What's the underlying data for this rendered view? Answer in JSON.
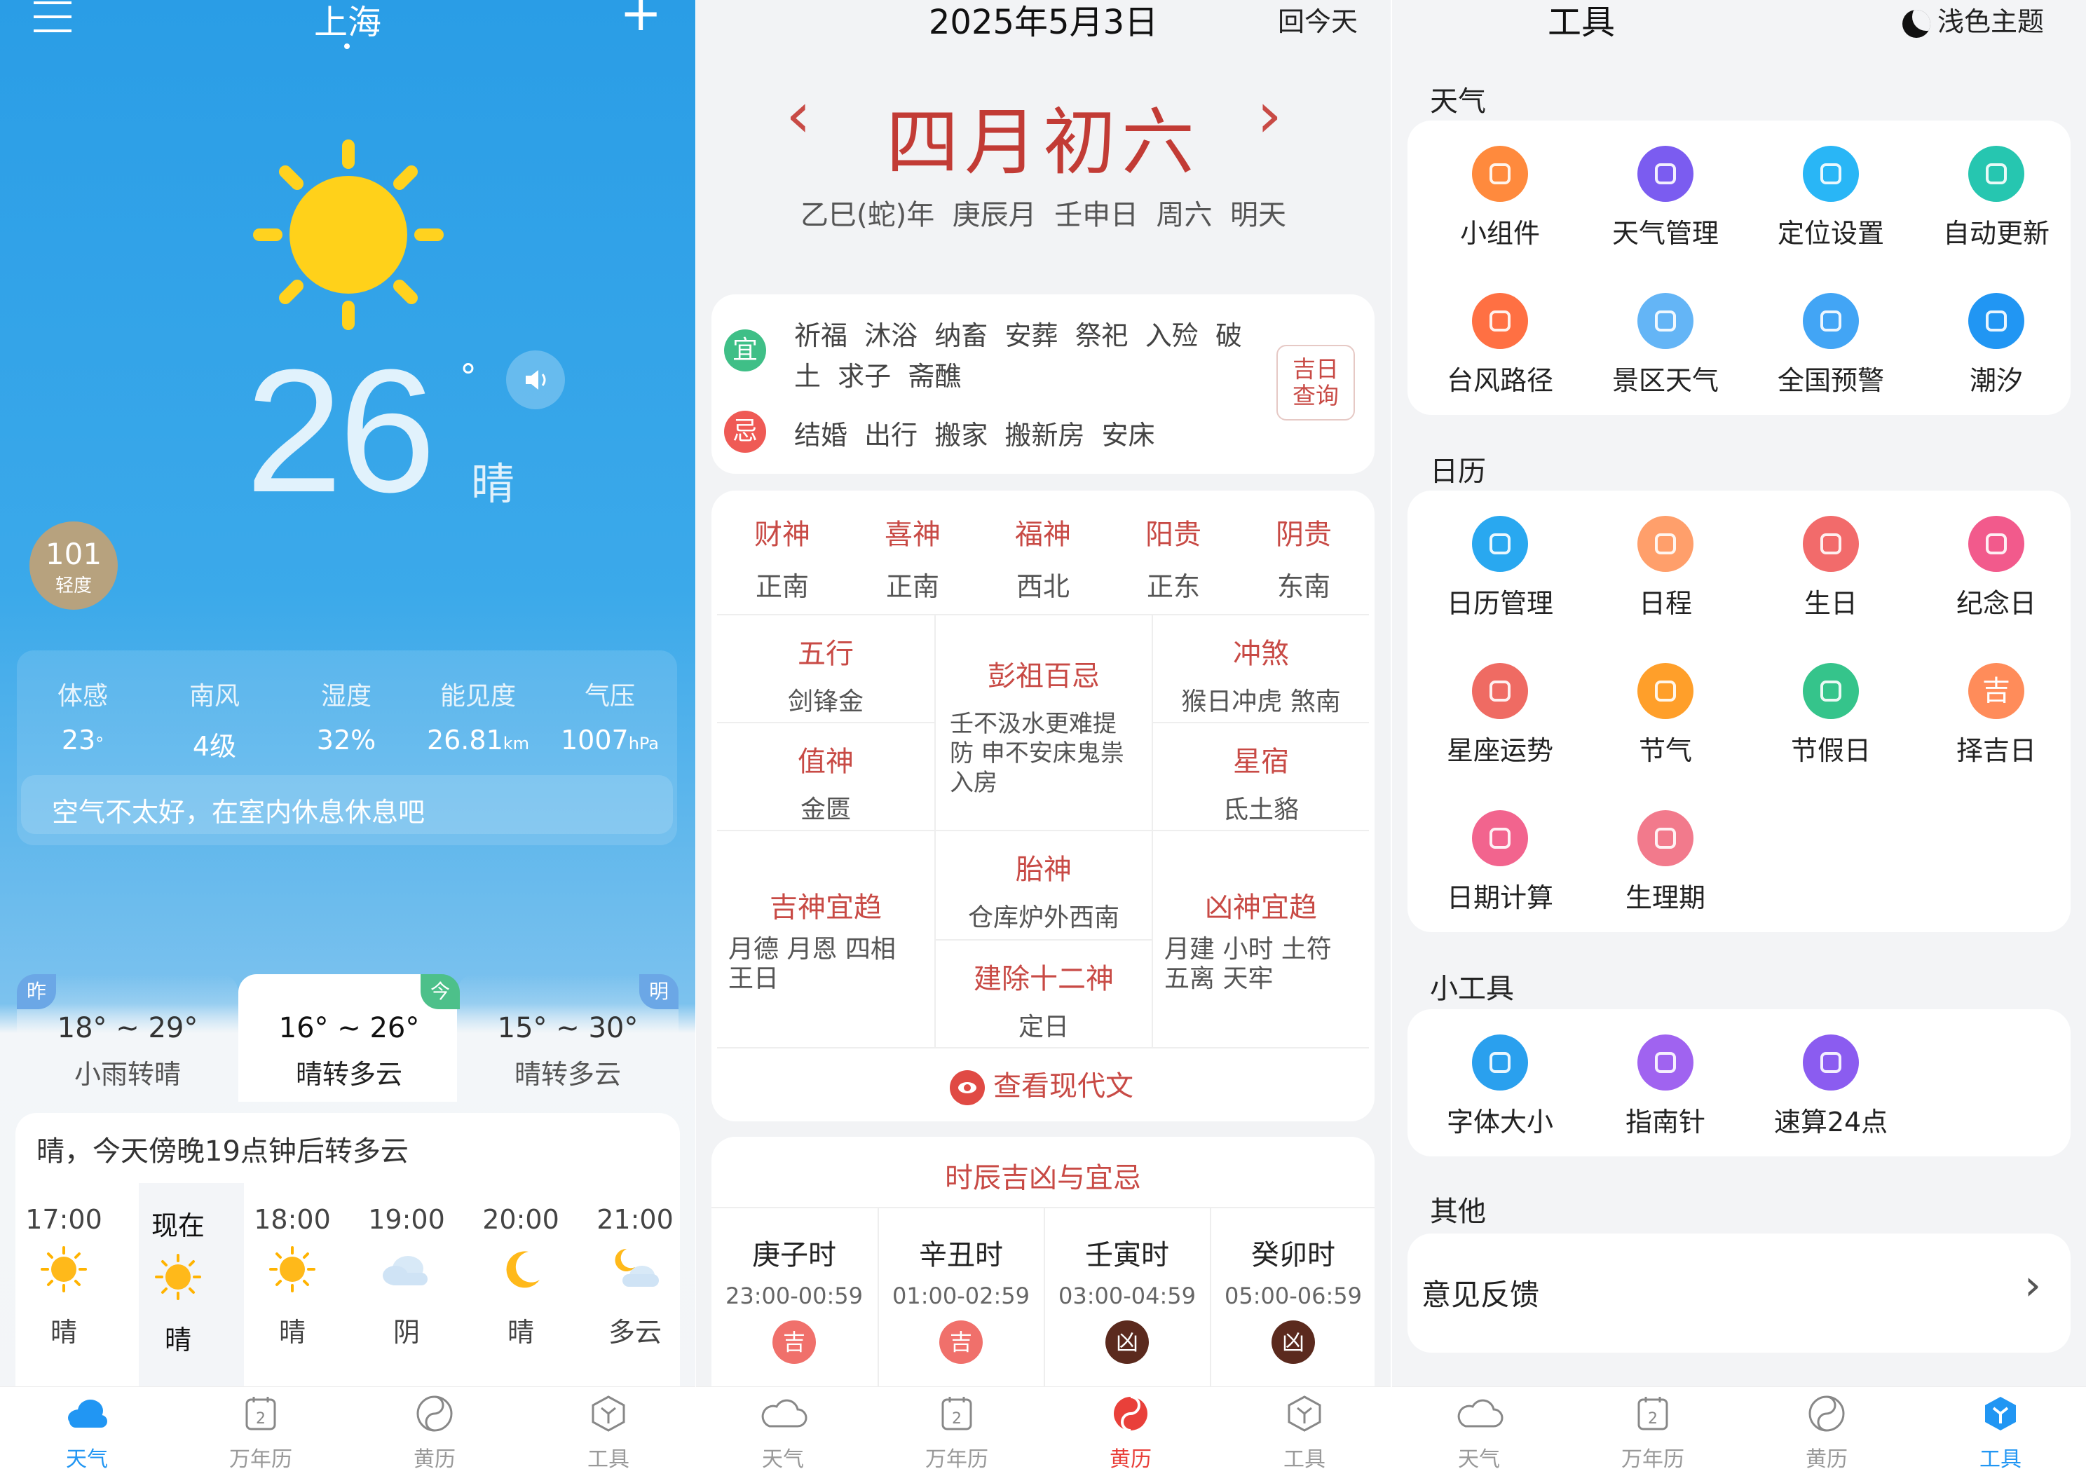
{
  "weather": {
    "city": "上海",
    "temp": "26",
    "degree": "°",
    "condition": "晴",
    "aqi_value": "101",
    "aqi_level": "轻度",
    "stats": [
      {
        "label": "体感",
        "value": "23",
        "unit": "°"
      },
      {
        "label": "南风",
        "value": "4级",
        "unit": ""
      },
      {
        "label": "湿度",
        "value": "32%",
        "unit": ""
      },
      {
        "label": "能见度",
        "value": "26.81",
        "unit": "km"
      },
      {
        "label": "气压",
        "value": "1007",
        "unit": "hPa"
      }
    ],
    "tip": "空气不太好，在室内休息休息吧",
    "days": [
      {
        "tag": "昨",
        "range": "18° ~ 29°",
        "desc": "小雨转晴"
      },
      {
        "tag": "今",
        "range": "16° ~ 26°",
        "desc": "晴转多云"
      },
      {
        "tag": "明",
        "range": "15° ~ 30°",
        "desc": "晴转多云"
      }
    ],
    "summary": "晴，今天傍晚19点钟后转多云",
    "hourly": [
      {
        "time": "17:00",
        "icon": "sun-icon",
        "cond": "晴"
      },
      {
        "time": "现在",
        "icon": "sun-icon",
        "cond": "晴"
      },
      {
        "time": "18:00",
        "icon": "sun-icon",
        "cond": "晴"
      },
      {
        "time": "19:00",
        "icon": "cloud-icon",
        "cond": "阴"
      },
      {
        "time": "20:00",
        "icon": "moon-icon",
        "cond": "晴"
      },
      {
        "time": "21:00",
        "icon": "moon-cloud-icon",
        "cond": "多云"
      }
    ]
  },
  "nav": [
    "天气",
    "万年历",
    "黄历",
    "工具"
  ],
  "almanac": {
    "date": "2025年5月3日",
    "today_btn": "回今天",
    "lunar": "四月初六",
    "ganzhi": "乙巳(蛇)年  庚辰月  壬申日  周六  明天",
    "yi_badge": "宜",
    "ji_badge": "忌",
    "yi_line1": "祈福  沐浴  纳畜  安葬  祭祀  入殓  破",
    "yi_line2": "土  求子  斋醮",
    "ji_line": "结婚  出行  搬家  搬新房  安床",
    "query_btn": [
      "吉日",
      "查询"
    ],
    "gods": [
      {
        "name": "财神",
        "dir": "正南"
      },
      {
        "name": "喜神",
        "dir": "正南"
      },
      {
        "name": "福神",
        "dir": "西北"
      },
      {
        "name": "阳贵",
        "dir": "正东"
      },
      {
        "name": "阴贵",
        "dir": "东南"
      }
    ],
    "wuxing_title": "五行",
    "wuxing_val": "剑锋金",
    "pengzu_title": "彭祖百忌",
    "pengzu_val": "壬不汲水更难提防 申不安床鬼祟入房",
    "chongsha_title": "冲煞",
    "chongsha_val": "猴日冲虎 煞南",
    "zhishen_title": "值神",
    "zhishen_val": "金匮",
    "xingxiu_title": "星宿",
    "xingxiu_val": "氐土貉",
    "taishen_title": "胎神",
    "taishen_val": "仓库炉外西南",
    "jishen_title": "吉神宜趋",
    "jishen_val": "月德 月恩 四相 王日",
    "xiongshen_title": "凶神宜趋",
    "xiongshen_val": "月建 小时 土符 五离 天牢",
    "jianchu_title": "建除十二神",
    "jianchu_val": "定日",
    "modern_btn": "查看现代文",
    "hours_title": "时辰吉凶与宜忌",
    "hours": [
      {
        "name": "庚子时",
        "range": "23:00-00:59",
        "luck": "吉"
      },
      {
        "name": "辛丑时",
        "range": "01:00-02:59",
        "luck": "吉"
      },
      {
        "name": "壬寅时",
        "range": "03:00-04:59",
        "luck": "凶"
      },
      {
        "name": "癸卯时",
        "range": "05:00-06:59",
        "luck": "凶"
      }
    ]
  },
  "tools": {
    "title": "工具",
    "theme": "浅色主题",
    "sections": {
      "weather": "天气",
      "calendar": "日历",
      "small": "小工具",
      "other": "其他"
    },
    "weather_items": [
      {
        "label": "小组件",
        "icon": "widget-icon",
        "color": "#ff8a3d"
      },
      {
        "label": "天气管理",
        "icon": "list-icon",
        "color": "#7b5cf0"
      },
      {
        "label": "定位设置",
        "icon": "location-icon",
        "color": "#29b6f6"
      },
      {
        "label": "自动更新",
        "icon": "refresh-icon",
        "color": "#26c6b0"
      },
      {
        "label": "台风路径",
        "icon": "typhoon-icon",
        "color": "#ff7043"
      },
      {
        "label": "景区天气",
        "icon": "scenic-icon",
        "color": "#64b5f6"
      },
      {
        "label": "全国预警",
        "icon": "warning-icon",
        "color": "#42a5f5"
      },
      {
        "label": "潮汐",
        "icon": "tide-icon",
        "color": "#2196f3"
      }
    ],
    "calendar_items": [
      {
        "label": "日历管理",
        "icon": "calendar-icon",
        "color": "#29a8f0"
      },
      {
        "label": "日程",
        "icon": "schedule-icon",
        "color": "#ff9f6b"
      },
      {
        "label": "生日",
        "icon": "cake-icon",
        "color": "#f26b6b"
      },
      {
        "label": "纪念日",
        "icon": "heart-icon",
        "color": "#f25a8c"
      },
      {
        "label": "星座运势",
        "icon": "aries-icon",
        "color": "#ef6b63"
      },
      {
        "label": "节气",
        "icon": "solar-term-icon",
        "color": "#ff9f2a"
      },
      {
        "label": "节假日",
        "icon": "holiday-icon",
        "color": "#35c48b"
      },
      {
        "label": "择吉日",
        "icon": "ji-icon",
        "color": "#ff8c5a",
        "glyph": "吉"
      },
      {
        "label": "日期计算",
        "icon": "date-calc-icon",
        "color": "#f2648e"
      },
      {
        "label": "生理期",
        "icon": "period-icon",
        "color": "#f27a8c"
      }
    ],
    "small_items": [
      {
        "label": "字体大小",
        "icon": "font-size-icon",
        "color": "#2aa0ee"
      },
      {
        "label": "指南针",
        "icon": "compass-icon",
        "color": "#a063f0"
      },
      {
        "label": "速算24点",
        "icon": "game-icon",
        "color": "#8b5cf0"
      }
    ],
    "feedback": "意见反馈"
  }
}
